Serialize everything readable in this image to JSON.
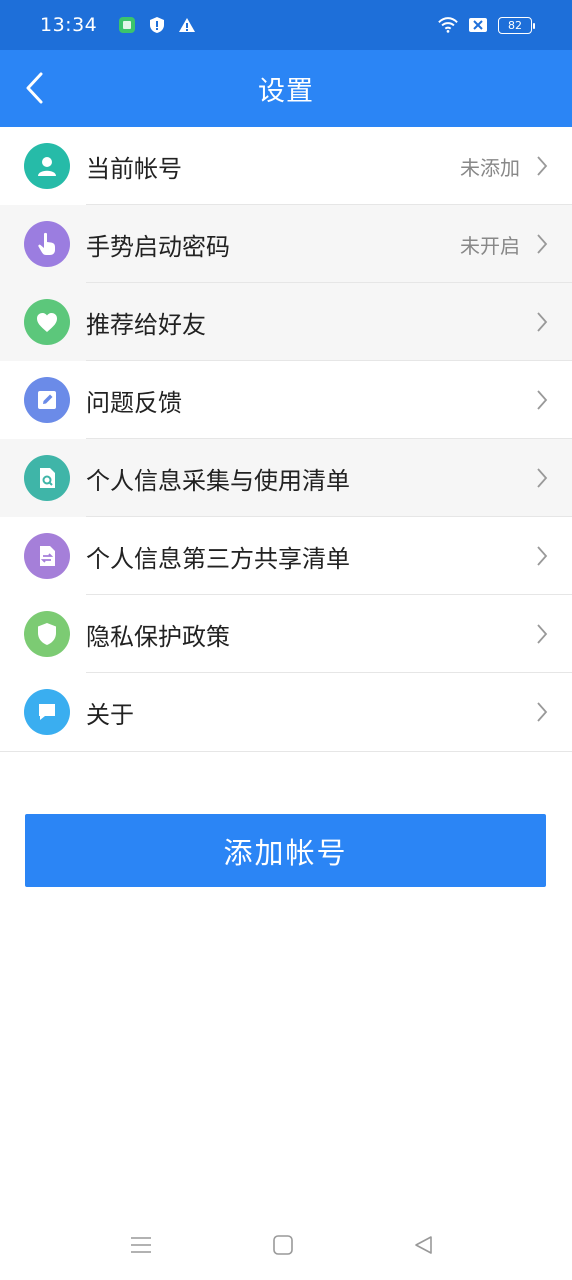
{
  "status_bar": {
    "time": "13:34",
    "battery": "82",
    "icons": [
      "sim-icon",
      "shield-icon",
      "warning-icon",
      "wifi-icon",
      "signal-off-icon",
      "battery-icon"
    ]
  },
  "header": {
    "title": "设置",
    "back_icon": "back-arrow-icon"
  },
  "settings": {
    "items": [
      {
        "label": "当前帐号",
        "value": "未添加",
        "icon": "user-icon",
        "color": "#26bba8"
      },
      {
        "label": "手势启动密码",
        "value": "未开启",
        "icon": "hand-pointer-icon",
        "color": "#9b7de0"
      },
      {
        "label": "推荐给好友",
        "value": "",
        "icon": "heart-icon",
        "color": "#5cc77b"
      },
      {
        "label": "问题反馈",
        "value": "",
        "icon": "edit-icon",
        "color": "#6b8be8"
      },
      {
        "label": "个人信息采集与使用清单",
        "value": "",
        "icon": "doc-search-icon",
        "color": "#3fb5a8"
      },
      {
        "label": "个人信息第三方共享清单",
        "value": "",
        "icon": "doc-share-icon",
        "color": "#a57fd9"
      },
      {
        "label": "隐私保护政策",
        "value": "",
        "icon": "shield-icon",
        "color": "#7ccb73"
      },
      {
        "label": "关于",
        "value": "",
        "icon": "chat-icon",
        "color": "#3aaef0"
      }
    ]
  },
  "main": {
    "add_account_label": "添加帐号"
  },
  "nav_bar": {
    "icons": [
      "menu-icon",
      "home-icon",
      "back-icon"
    ]
  },
  "colors": {
    "status_bar": "#1e6fd9",
    "title_bar": "#2b85f5",
    "button": "#2b85f5"
  }
}
